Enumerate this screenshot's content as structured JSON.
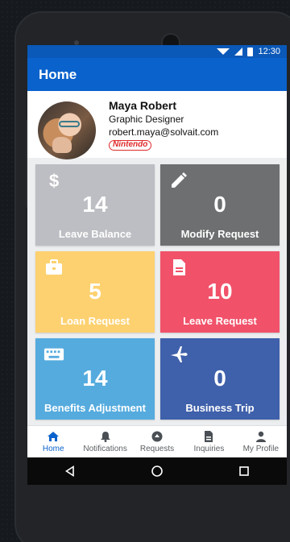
{
  "status_bar": {
    "time": "12:30"
  },
  "app_bar": {
    "title": "Home"
  },
  "profile": {
    "name": "Maya Robert",
    "role": "Graphic Designer",
    "email": "robert.maya@solvait.com",
    "company_badge": "Nintendo"
  },
  "tiles": [
    {
      "value": "14",
      "label": "Leave Balance",
      "icon": "dollar-icon",
      "color": "#bdbec3"
    },
    {
      "value": "0",
      "label": "Modify Request",
      "icon": "pencil-icon",
      "color": "#6d6f70"
    },
    {
      "value": "5",
      "label": "Loan Request",
      "icon": "briefcase-icon",
      "color": "#fdd170"
    },
    {
      "value": "10",
      "label": "Leave Request",
      "icon": "document-icon",
      "color": "#f1526a"
    },
    {
      "value": "14",
      "label": "Benefits Adjustment",
      "icon": "keyboard-icon",
      "color": "#55abde"
    },
    {
      "value": "0",
      "label": "Business Trip",
      "icon": "airplane-icon",
      "color": "#3f60aa"
    }
  ],
  "bottom_nav": [
    {
      "label": "Home",
      "icon": "home-icon",
      "active": true
    },
    {
      "label": "Notifications",
      "icon": "bell-icon",
      "active": false
    },
    {
      "label": "Requests",
      "icon": "requests-icon",
      "active": false
    },
    {
      "label": "Inquiries",
      "icon": "inquiries-icon",
      "active": false
    },
    {
      "label": "My Profile",
      "icon": "person-icon",
      "active": false
    }
  ],
  "system_nav": [
    "back-icon",
    "home-circle-icon",
    "recents-icon"
  ],
  "colors": {
    "primary": "#0a62cc",
    "status_bar": "#0a58b8",
    "accent_active": "#0a62cc",
    "badge_red": "#e02a2a"
  }
}
